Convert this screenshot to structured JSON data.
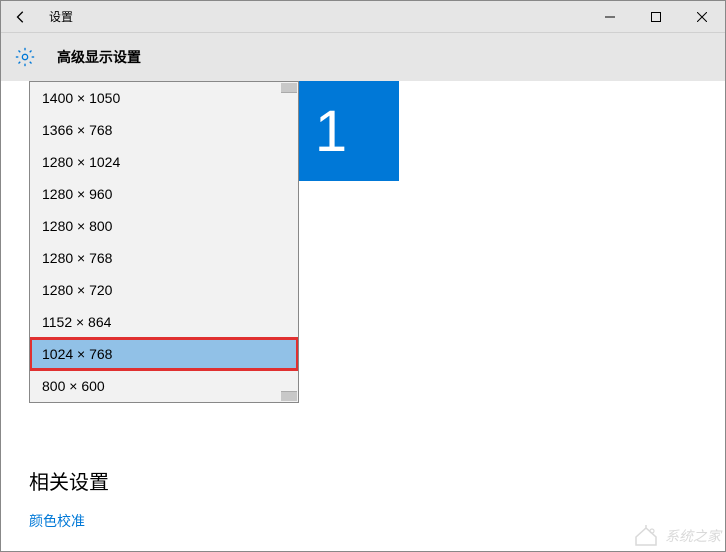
{
  "window": {
    "title": "设置",
    "subtitle": "高级显示设置"
  },
  "monitor": {
    "label": "1"
  },
  "resolutions": [
    {
      "label": "1400 × 1050",
      "selected": false
    },
    {
      "label": "1366 × 768",
      "selected": false
    },
    {
      "label": "1280 × 1024",
      "selected": false
    },
    {
      "label": "1280 × 960",
      "selected": false
    },
    {
      "label": "1280 × 800",
      "selected": false
    },
    {
      "label": "1280 × 768",
      "selected": false
    },
    {
      "label": "1280 × 720",
      "selected": false
    },
    {
      "label": "1152 × 864",
      "selected": false
    },
    {
      "label": "1024 × 768",
      "selected": true
    },
    {
      "label": "800 × 600",
      "selected": false
    }
  ],
  "related": {
    "heading": "相关设置",
    "link": "颜色校准"
  },
  "watermark": "系统之家"
}
